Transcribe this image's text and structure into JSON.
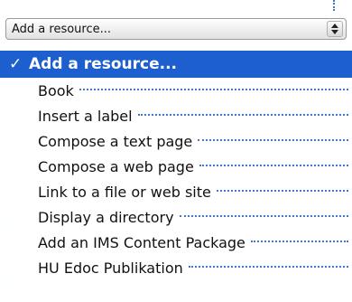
{
  "select": {
    "value": "Add a resource...",
    "arrow_icon": "updown-arrows-icon"
  },
  "menu": {
    "selected": {
      "check": "✓",
      "label": "Add a resource..."
    },
    "items": [
      {
        "label": "Book"
      },
      {
        "label": "Insert a label"
      },
      {
        "label": "Compose a text page"
      },
      {
        "label": "Compose a web page"
      },
      {
        "label": "Link to a file or web site"
      },
      {
        "label": "Display a directory"
      },
      {
        "label": "Add an IMS Content Package"
      },
      {
        "label": "HU Edoc Publikation"
      }
    ]
  },
  "colors": {
    "highlight": "#1e5fcf",
    "leader": "#3f78c4"
  }
}
